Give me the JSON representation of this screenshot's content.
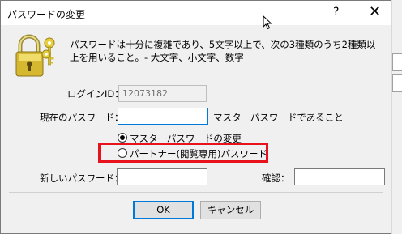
{
  "window": {
    "title": "パスワードの変更",
    "help_glyph": "?",
    "close_glyph": "✕"
  },
  "description": "パスワードは十分に複雑であり、5文字以上で、次の3種類のうち2種類以上を用いること。- 大文字、小文字、数字",
  "login": {
    "label": "ログインID：",
    "value": "12073182"
  },
  "current_password": {
    "label": "現在のパスワード：",
    "value": "",
    "hint": "マスターパスワードであること"
  },
  "password_type": {
    "options": [
      {
        "label": "マスターパスワードの変更",
        "selected": true
      },
      {
        "label": "パートナー(閲覧専用)パスワード",
        "selected": false
      }
    ]
  },
  "new_password": {
    "label": "新しいパスワード：",
    "value": ""
  },
  "confirm": {
    "label": "確認：",
    "value": ""
  },
  "buttons": {
    "ok": "OK",
    "cancel": "キャンセル"
  },
  "colors": {
    "highlight": "#e8121c",
    "focus": "#0078d7"
  }
}
